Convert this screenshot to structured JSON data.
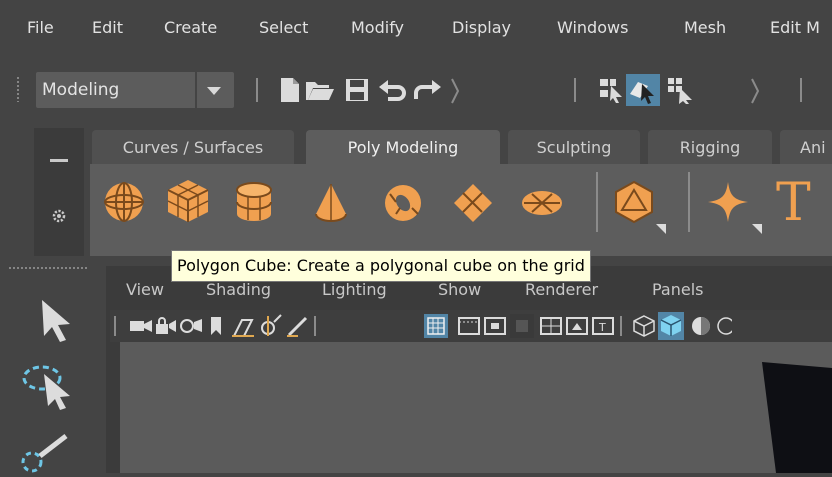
{
  "menubar": {
    "items": [
      "File",
      "Edit",
      "Create",
      "Select",
      "Modify",
      "Display",
      "Windows",
      "Mesh",
      "Edit M"
    ]
  },
  "statusline": {
    "mode_selector": {
      "value": "Modeling"
    }
  },
  "shelf": {
    "tabs": [
      {
        "label": "Curves / Surfaces",
        "active": false
      },
      {
        "label": "Poly Modeling",
        "active": true
      },
      {
        "label": "Sculpting",
        "active": false
      },
      {
        "label": "Rigging",
        "active": false
      },
      {
        "label": "Ani",
        "active": false
      }
    ],
    "icons": [
      "sphere-icon",
      "cube-icon",
      "cylinder-icon",
      "cone-icon",
      "torus-icon",
      "plane-icon",
      "disc-icon",
      "platonic-icon",
      "sweep-mesh-icon",
      "text-icon"
    ]
  },
  "panel": {
    "menus": [
      "View",
      "Shading",
      "Lighting",
      "Show",
      "Renderer",
      "Panels"
    ]
  },
  "tooltip": {
    "text": "Polygon Cube: Create a polygonal cube on the grid"
  },
  "colors": {
    "accent_orange": "#f0a050",
    "selected_blue": "#5285a6",
    "tooltip_bg": "#ffffdc"
  }
}
